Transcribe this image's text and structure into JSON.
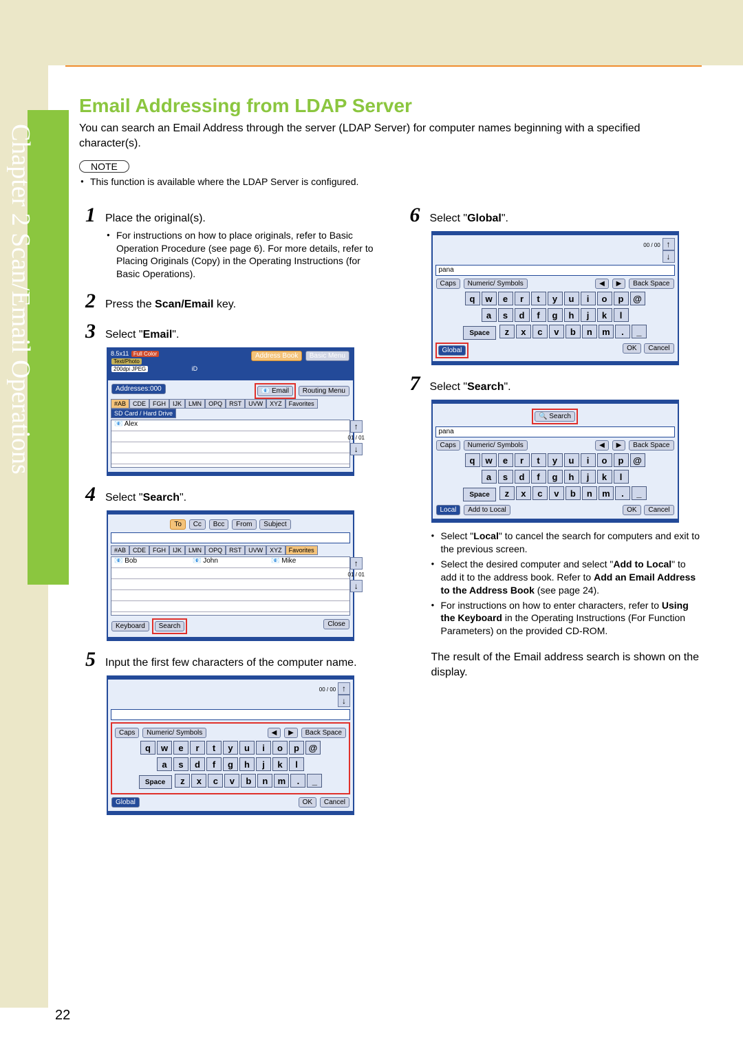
{
  "chapter_label": "Chapter 2    Scan/Email Operations",
  "section_title": "Email Addressing from LDAP Server",
  "intro": "You can search an Email Address through the server (LDAP Server) for computer names beginning with a specified character(s).",
  "note_label": "NOTE",
  "note_items": [
    "This function is available where the LDAP Server is configured."
  ],
  "steps": {
    "s1": {
      "num": "1",
      "text_a": "Place the original(s).",
      "sub": [
        "For instructions on how to place originals, refer to Basic Operation Procedure (see page 6). For more details, refer to Placing Originals (Copy) in the Operating Instructions (for Basic Operations)."
      ]
    },
    "s2": {
      "num": "2",
      "pre": "Press the ",
      "bold": "Scan/Email",
      "post": " key."
    },
    "s3": {
      "num": "3",
      "pre": "Select \"",
      "bold": "Email",
      "post": "\"."
    },
    "s4": {
      "num": "4",
      "pre": "Select \"",
      "bold": "Search",
      "post": "\"."
    },
    "s5": {
      "num": "5",
      "text": "Input the first few characters of the computer name."
    },
    "s6": {
      "num": "6",
      "pre": "Select \"",
      "bold": "Global",
      "post": "\"."
    },
    "s7": {
      "num": "7",
      "pre": "Select \"",
      "bold": "Search",
      "post": "\"."
    }
  },
  "step7_sub": [
    {
      "a": "Select \"",
      "b": "Local",
      "c": "\" to cancel the search for computers and exit to the previous screen."
    },
    {
      "a": "Select the desired computer and select \"",
      "b": "Add to Local",
      "c": "\" to add it to the address book. Refer to ",
      "d": "Add an Email Address to the Address Book",
      "e": " (see page 24)."
    },
    {
      "a": "For instructions on how to enter characters, refer to ",
      "b": "Using the Keyboard",
      "c": " in the Operating Instructions (For Function Parameters) on the provided CD-ROM."
    }
  ],
  "result_text": "The result of the Email address search is shown on the display.",
  "page_number": "22",
  "shot3": {
    "info1": "8.5x11",
    "fullcolor": "Full Color",
    "textphoto": "Text/Photo",
    "dpi": "200dpi JPEG",
    "addresses": "Addresses:000",
    "address_book": "Address Book",
    "basic_menu": "Basic Menu",
    "email": "Email",
    "routing": "Routing Menu",
    "tabs": [
      "#AB",
      "CDE",
      "FGH",
      "IJK",
      "LMN",
      "OPQ",
      "RST",
      "UVW",
      "XYZ",
      "Favorites"
    ],
    "sdcard": "SD Card / Hard Drive",
    "row1": "Alex",
    "frac": "01 / 01"
  },
  "shot4": {
    "top_tabs": [
      "To",
      "Cc",
      "Bcc",
      "From",
      "Subject"
    ],
    "tabs": [
      "#AB",
      "CDE",
      "FGH",
      "IJK",
      "LMN",
      "OPQ",
      "RST",
      "UVW",
      "XYZ",
      "Favorites"
    ],
    "n1": "Bob",
    "n2": "John",
    "n3": "Mike",
    "keyboard": "Keyboard",
    "search": "Search",
    "close": "Close",
    "frac": "01 / 01"
  },
  "shot_kbd": {
    "pana": "pana",
    "caps": "Caps",
    "numsym": "Numeric/ Symbols",
    "back": "Back Space",
    "row1": [
      "q",
      "w",
      "e",
      "r",
      "t",
      "y",
      "u",
      "i",
      "o",
      "p",
      "@"
    ],
    "row2": [
      "a",
      "s",
      "d",
      "f",
      "g",
      "h",
      "j",
      "k",
      "l"
    ],
    "space": "Space",
    "row3": [
      "z",
      "x",
      "c",
      "v",
      "b",
      "n",
      "m",
      ".",
      "_"
    ],
    "global": "Global",
    "ok": "OK",
    "cancel": "Cancel",
    "local": "Local",
    "addlocal": "Add to Local",
    "search": "Search",
    "frac": "00 / 00"
  }
}
